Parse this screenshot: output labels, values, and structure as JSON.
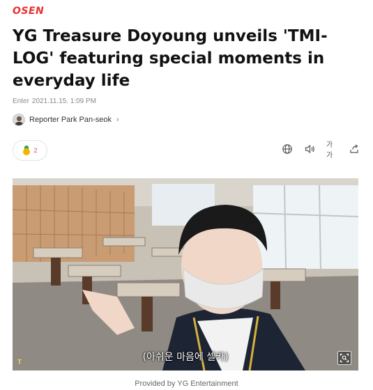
{
  "site": {
    "logo_text": "OSEN"
  },
  "article": {
    "headline": "YG Treasure Doyoung unveils 'TMI-LOG' featuring special moments in everyday life",
    "date_prefix": "Enter",
    "date": "2021.11.15. 1:09 PM",
    "reporter": "Reporter Park Pan-seok",
    "reaction_count": "2"
  },
  "toolbar": {
    "icons": [
      "globe-icon",
      "speaker-icon",
      "font-size-icon",
      "share-icon"
    ],
    "font_size_label": "가가"
  },
  "photo": {
    "subtitle": "(아쉬운 마음에 셀카)",
    "credit": "Provided by YG Entertainment",
    "corner_mark": "T"
  },
  "colors": {
    "brand": "#e8312f",
    "reaction": "#e0487a"
  }
}
